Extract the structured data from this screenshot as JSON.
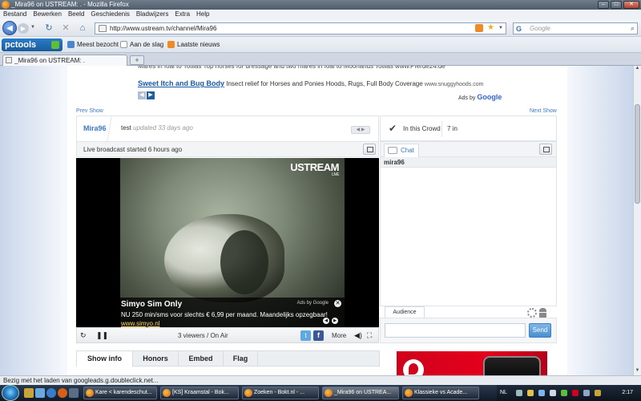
{
  "window": {
    "title": "_Mira96 on USTREAM: . - Mozilla Firefox"
  },
  "menu": [
    "Bestand",
    "Bewerken",
    "Beeld",
    "Geschiedenis",
    "Bladwijzers",
    "Extra",
    "Help"
  ],
  "nav": {
    "url": "http://www.ustream.tv/channel/Mira96",
    "search_placeholder": "Google"
  },
  "bookmarks": {
    "toolbar_brand": "pctools",
    "items": [
      "Meest bezocht",
      "Aan de slag",
      "Laatste nieuws"
    ]
  },
  "tab": {
    "label": "_Mira96 on USTREAM: ."
  },
  "ads": {
    "cut_line": "Mares in foal to Totilas  Top horses for dressage and two mares in foal to Moorlands Totilas www.Pferde24.de",
    "link": "Sweet Itch and Bug Body",
    "text": " Insect relief for Horses and Ponies Hoods, Rugs, Full Body Coverage ",
    "url": "www.snuggyhoods.com",
    "ads_by": "Ads by",
    "google": "Google"
  },
  "show_nav": {
    "prev": "Prev Show",
    "next": "Next Show"
  },
  "channel": {
    "name": "Mira96",
    "user": "test",
    "updated": "updated 33 days ago",
    "live_text": "Live broadcast started 6 hours ago"
  },
  "video": {
    "brand": "USTREAM",
    "brand_sub": "LIVE",
    "ad": {
      "title": "Simyo Sim Only",
      "desc": "NU 250 min/sms voor slechts € 6,99 per maand. Maandelijks opzegbaar!",
      "url": "www.simyo.nl",
      "by": "Ads by Google"
    },
    "viewers": "3 viewers / On Air",
    "more": "More"
  },
  "crowd": {
    "label": "In this Crowd",
    "count": "7 in"
  },
  "chat": {
    "tab": "Chat",
    "user": "mira96",
    "audience": "Audience",
    "send": "Send"
  },
  "info_tabs": [
    "Show info",
    "Honors",
    "Embed",
    "Flag"
  ],
  "status_text": "Bezig met het laden van googleads.g.doubleclick.net...",
  "taskbar": {
    "tasks": [
      "Kare < karendeschut...",
      "[KS] Kraamstal - Bok...",
      "Zoeken - Bokt.nl - ...",
      "_Mira96 on USTREA...",
      "Klassieke vs Acade..."
    ],
    "lang": "NL",
    "clock": "2:17"
  }
}
